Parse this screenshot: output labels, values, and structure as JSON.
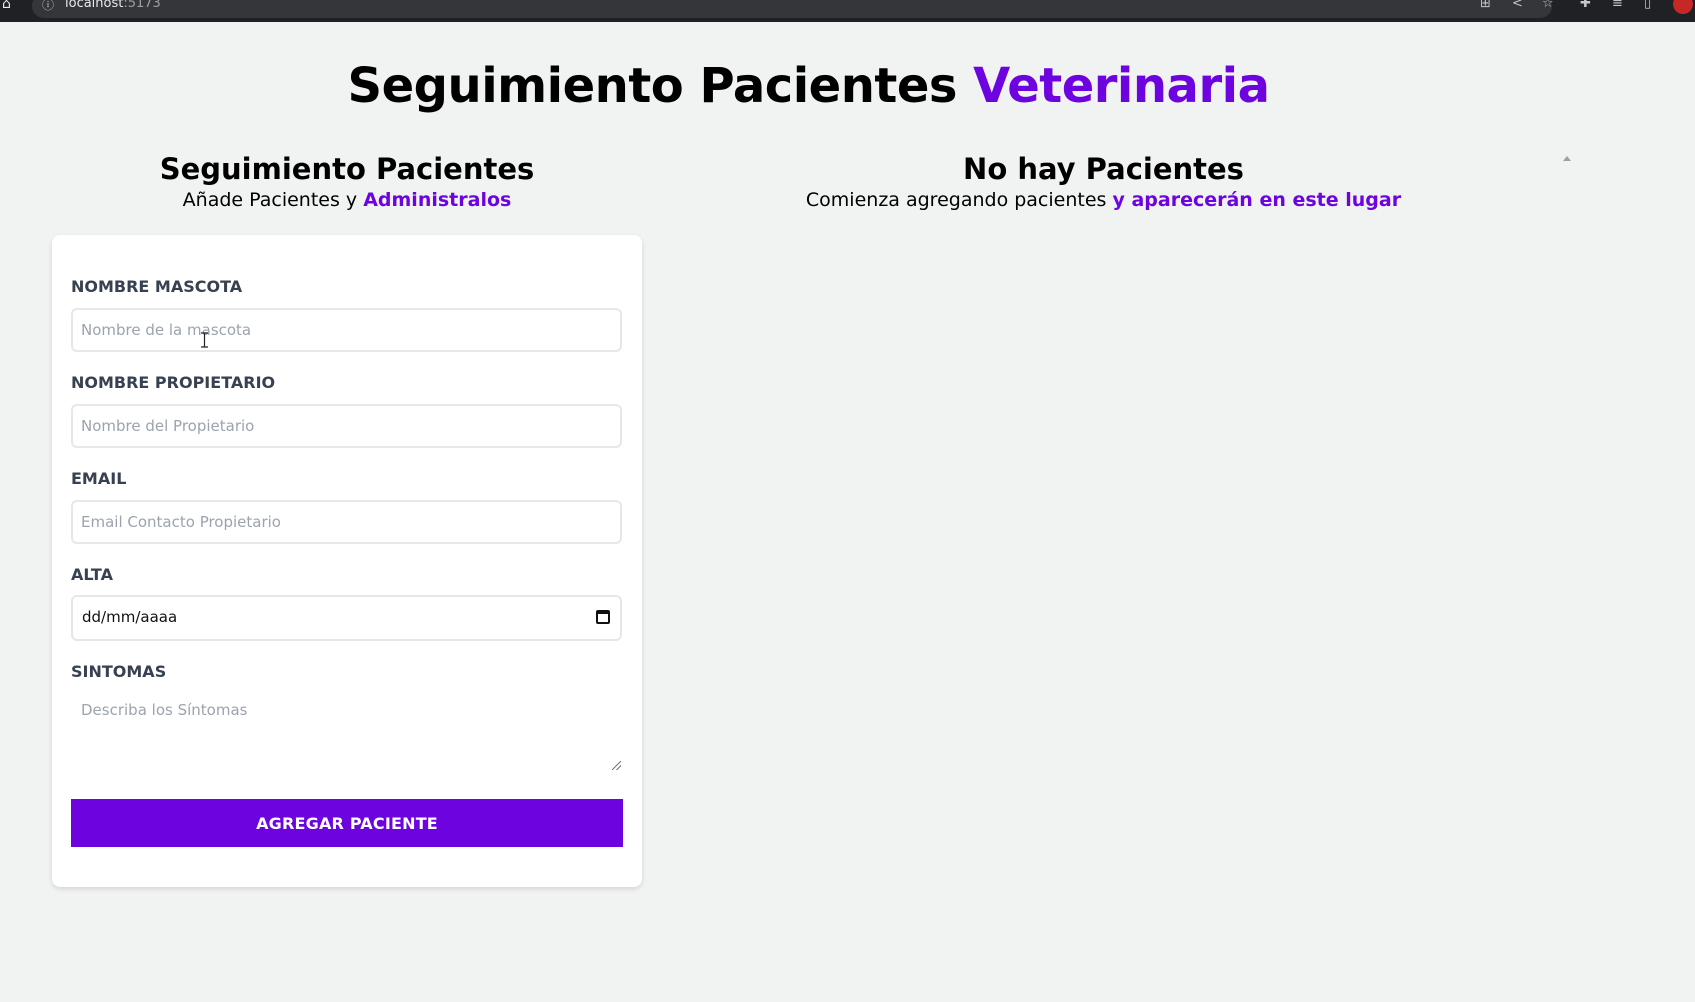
{
  "browser": {
    "url_host": "localhost",
    "url_port": ":5173",
    "icons": [
      "home-icon",
      "info-icon",
      "translate-icon",
      "share-icon",
      "star-icon",
      "extensions-icon",
      "media-icon",
      "sidebar-icon",
      "avatar"
    ]
  },
  "header": {
    "title_main": "Seguimiento Pacientes ",
    "title_accent": "Veterinaria"
  },
  "form_section": {
    "title": "Seguimiento Pacientes",
    "subtitle_plain": "Añade Pacientes y ",
    "subtitle_accent": "Administralos"
  },
  "form": {
    "pet_name": {
      "label": "NOMBRE MASCOTA",
      "placeholder": "Nombre de la mascota",
      "value": ""
    },
    "owner_name": {
      "label": "NOMBRE PROPIETARIO",
      "placeholder": "Nombre del Propietario",
      "value": ""
    },
    "email": {
      "label": "EMAIL",
      "placeholder": "Email Contacto Propietario",
      "value": ""
    },
    "discharge": {
      "label": "ALTA",
      "value": "dd/mm/aaaa"
    },
    "symptoms": {
      "label": "SINTOMAS",
      "placeholder": "Describa los Síntomas",
      "value": ""
    },
    "submit_label": "AGREGAR PACIENTE"
  },
  "patients_section": {
    "title": "No hay Pacientes",
    "subtitle_plain": "Comienza agregando pacientes ",
    "subtitle_accent": "y aparecerán en este lugar"
  },
  "colors": {
    "accent": "#6d04e0",
    "background": "#f1f2f2",
    "card": "#ffffff",
    "label": "#374151"
  }
}
